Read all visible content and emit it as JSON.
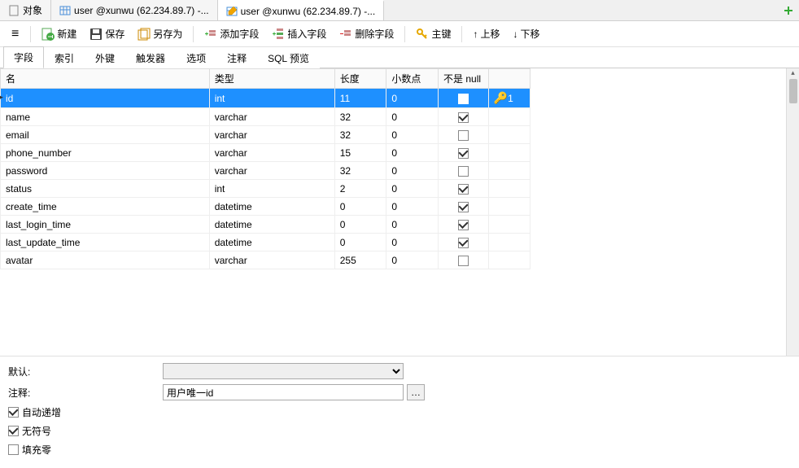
{
  "topTabs": [
    {
      "label": "对象",
      "icon": "doc"
    },
    {
      "label": "user @xunwu (62.234.89.7) -...",
      "icon": "table"
    },
    {
      "label": "user @xunwu (62.234.89.7) -...",
      "icon": "design",
      "active": true
    }
  ],
  "toolbar": {
    "new": "新建",
    "save": "保存",
    "saveAs": "另存为",
    "addField": "添加字段",
    "insertField": "插入字段",
    "deleteField": "删除字段",
    "primaryKey": "主键",
    "moveUp": "上移",
    "moveDown": "下移"
  },
  "subTabs": [
    "字段",
    "索引",
    "外键",
    "触发器",
    "选项",
    "注释",
    "SQL 预览"
  ],
  "activeSubTab": 0,
  "gridHeaders": {
    "name": "名",
    "type": "类型",
    "length": "长度",
    "decimals": "小数点",
    "notNull": "不是 null",
    "key": ""
  },
  "rows": [
    {
      "name": "id",
      "type": "int",
      "length": "11",
      "decimals": "0",
      "notNull": true,
      "key": "1",
      "selected": true
    },
    {
      "name": "name",
      "type": "varchar",
      "length": "32",
      "decimals": "0",
      "notNull": true
    },
    {
      "name": "email",
      "type": "varchar",
      "length": "32",
      "decimals": "0",
      "notNull": false
    },
    {
      "name": "phone_number",
      "type": "varchar",
      "length": "15",
      "decimals": "0",
      "notNull": true
    },
    {
      "name": "password",
      "type": "varchar",
      "length": "32",
      "decimals": "0",
      "notNull": false
    },
    {
      "name": "status",
      "type": "int",
      "length": "2",
      "decimals": "0",
      "notNull": true
    },
    {
      "name": "create_time",
      "type": "datetime",
      "length": "0",
      "decimals": "0",
      "notNull": true
    },
    {
      "name": "last_login_time",
      "type": "datetime",
      "length": "0",
      "decimals": "0",
      "notNull": true
    },
    {
      "name": "last_update_time",
      "type": "datetime",
      "length": "0",
      "decimals": "0",
      "notNull": true
    },
    {
      "name": "avatar",
      "type": "varchar",
      "length": "255",
      "decimals": "0",
      "notNull": false
    }
  ],
  "detail": {
    "defaultLabel": "默认:",
    "defaultValue": "",
    "commentLabel": "注释:",
    "commentValue": "用户唯一id",
    "autoInc": "自动递增",
    "autoIncChecked": true,
    "unsigned": "无符号",
    "unsignedChecked": true,
    "zerofill": "填充零",
    "zerofillChecked": false
  }
}
